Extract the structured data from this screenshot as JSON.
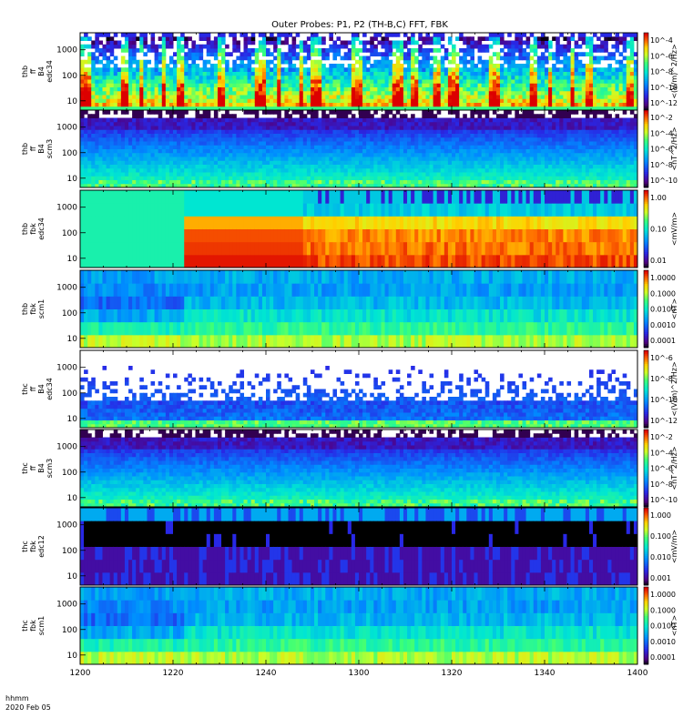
{
  "chart_data": {
    "type": "heatmap",
    "title": "Outer Probes: P1, P2 (TH-B,C) FFT, FBK",
    "x": {
      "ticks": [
        "1200",
        "1220",
        "1240",
        "1300",
        "1320",
        "1340",
        "1400"
      ],
      "corner_label_line1": "hhmm",
      "corner_label_line2": "2020 Feb 05"
    },
    "panels": [
      {
        "id": "thb-ff-b4-edc34",
        "ylabel": [
          "thb",
          "ff",
          "B4",
          "edc34"
        ],
        "yticks": [
          "1000",
          "100",
          "10"
        ],
        "style": "fft_e",
        "colorbar": {
          "unit": "<(V/m)^2/Hz>",
          "ticks": [
            "10^-4",
            "10^-6",
            "10^-8",
            "10^-10",
            "10^-12"
          ]
        }
      },
      {
        "id": "thb-ff-b4-scm3",
        "ylabel": [
          "thb",
          "ff",
          "B4",
          "scm3"
        ],
        "yticks": [
          "1000",
          "100",
          "10"
        ],
        "style": "fft_b",
        "colorbar": {
          "unit": "<nT^2/Hz>",
          "ticks": [
            "10^-2",
            "10^-4",
            "10^-6",
            "10^-8",
            "10^-10"
          ]
        }
      },
      {
        "id": "thb-fbk-edc34",
        "ylabel": [
          "thb",
          "fbk",
          "edc34"
        ],
        "yticks": [
          "1000",
          "100",
          "10"
        ],
        "style": "fbk_e_b",
        "colorbar": {
          "unit": "<mV/m>",
          "ticks": [
            "1.00",
            "0.10",
            "0.01"
          ]
        }
      },
      {
        "id": "thb-fbk-scm1",
        "ylabel": [
          "thb",
          "fbk",
          "scm1"
        ],
        "yticks": [
          "1000",
          "100",
          "10"
        ],
        "style": "fbk_b",
        "colorbar": {
          "unit": "<nT>",
          "ticks": [
            "1.0000",
            "0.1000",
            "0.0100",
            "0.0010",
            "0.0001"
          ]
        }
      },
      {
        "id": "thc-ff-b4-edc34",
        "ylabel": [
          "thc",
          "ff",
          "B4",
          "edc34"
        ],
        "yticks": [
          "1000",
          "100",
          "10"
        ],
        "style": "fft_e2",
        "colorbar": {
          "unit": "<(V/m)^2/Hz>",
          "ticks": [
            "10^-6",
            "10^-8",
            "10^-10",
            "10^-12"
          ]
        }
      },
      {
        "id": "thc-ff-b4-scm3",
        "ylabel": [
          "thc",
          "ff",
          "B4",
          "scm3"
        ],
        "yticks": [
          "1000",
          "100",
          "10"
        ],
        "style": "fft_b",
        "colorbar": {
          "unit": "<nT^2/Hz>",
          "ticks": [
            "10^-2",
            "10^-4",
            "10^-6",
            "10^-8",
            "10^-10"
          ]
        }
      },
      {
        "id": "thc-fbk-edc12",
        "ylabel": [
          "thc",
          "fbk",
          "edc12"
        ],
        "yticks": [
          "1000",
          "100",
          "10"
        ],
        "style": "fbk_e_c",
        "colorbar": {
          "unit": "<mV/m>",
          "ticks": [
            "1.000",
            "0.100",
            "0.010",
            "0.001"
          ]
        }
      },
      {
        "id": "thc-fbk-scm1",
        "ylabel": [
          "thc",
          "fbk",
          "scm1"
        ],
        "yticks": [
          "1000",
          "100",
          "10"
        ],
        "style": "fbk_b",
        "colorbar": {
          "unit": "<nT>",
          "ticks": [
            "1.0000",
            "0.1000",
            "0.0100",
            "0.0010",
            "0.0001"
          ]
        }
      }
    ]
  }
}
